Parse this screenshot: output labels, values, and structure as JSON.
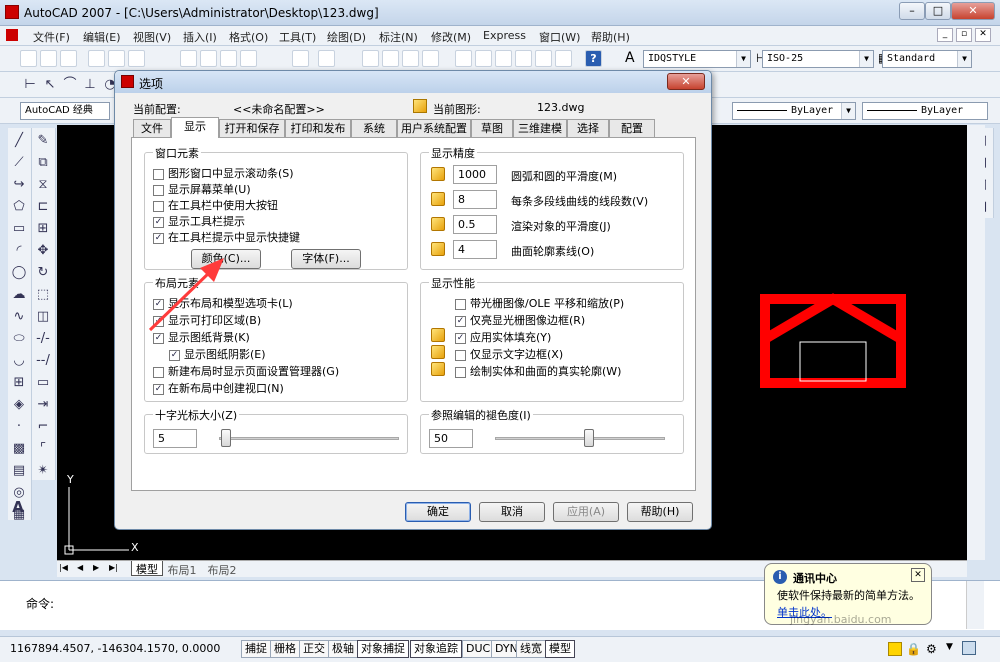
{
  "app": {
    "title": "AutoCAD 2007 - [C:\\Users\\Administrator\\Desktop\\123.dwg]"
  },
  "menu": [
    "文件(F)",
    "编辑(E)",
    "视图(V)",
    "插入(I)",
    "格式(O)",
    "工具(T)",
    "绘图(D)",
    "标注(N)",
    "修改(M)",
    "Express",
    "窗口(W)",
    "帮助(H)"
  ],
  "toolbar": {
    "textstyle": "IDQSTYLE",
    "dimstyle": "ISO-25",
    "tablestyle": "Standard",
    "workspace": "AutoCAD 经典",
    "linetype": "ByLayer",
    "lineweight": "ByLayer"
  },
  "dialog": {
    "title": "选项",
    "profile_label": "当前配置:",
    "profile_value": "<<未命名配置>>",
    "drawing_label": "当前图形:",
    "drawing_value": "123.dwg",
    "tabs": [
      "文件",
      "显示",
      "打开和保存",
      "打印和发布",
      "系统",
      "用户系统配置",
      "草图",
      "三维建模",
      "选择",
      "配置"
    ],
    "window_elements": {
      "title": "窗口元素",
      "items": [
        {
          "label": "图形窗口中显示滚动条(S)",
          "checked": false
        },
        {
          "label": "显示屏幕菜单(U)",
          "checked": false
        },
        {
          "label": "在工具栏中使用大按钮",
          "checked": false
        },
        {
          "label": "显示工具栏提示",
          "checked": true
        },
        {
          "label": "在工具栏提示中显示快捷键",
          "checked": true
        }
      ],
      "color_button": "颜色(C)...",
      "font_button": "字体(F)..."
    },
    "resolution": {
      "title": "显示精度",
      "items": [
        {
          "value": "1000",
          "label": "圆弧和圆的平滑度(M)"
        },
        {
          "value": "8",
          "label": "每条多段线曲线的线段数(V)"
        },
        {
          "value": "0.5",
          "label": "渲染对象的平滑度(J)"
        },
        {
          "value": "4",
          "label": "曲面轮廓素线(O)"
        }
      ]
    },
    "layout_elements": {
      "title": "布局元素",
      "items": [
        {
          "label": "显示布局和模型选项卡(L)",
          "checked": true
        },
        {
          "label": "显示可打印区域(B)",
          "checked": true
        },
        {
          "label": "显示图纸背景(K)",
          "checked": true
        },
        {
          "label": "显示图纸阴影(E)",
          "checked": true
        },
        {
          "label": "新建布局时显示页面设置管理器(G)",
          "checked": false
        },
        {
          "label": "在新布局中创建视口(N)",
          "checked": true
        }
      ]
    },
    "performance": {
      "title": "显示性能",
      "items": [
        {
          "label": "带光栅图像/OLE 平移和缩放(P)",
          "checked": false
        },
        {
          "label": "仅亮显光栅图像边框(R)",
          "checked": true
        },
        {
          "label": "应用实体填充(Y)",
          "checked": true
        },
        {
          "label": "仅显示文字边框(X)",
          "checked": false
        },
        {
          "label": "绘制实体和曲面的真实轮廓(W)",
          "checked": false
        }
      ]
    },
    "crosshair": {
      "title": "十字光标大小(Z)",
      "value": "5",
      "level": 5
    },
    "xref_fade": {
      "title": "参照编辑的褪色度(I)",
      "value": "50",
      "level": 50
    },
    "buttons": {
      "ok": "确定",
      "cancel": "取消",
      "apply": "应用(A)",
      "help": "帮助(H)"
    }
  },
  "layout_tabs": [
    "模型",
    "布局1",
    "布局2"
  ],
  "ucs": {
    "x": "X",
    "y": "Y"
  },
  "command": {
    "prompt": "命令:"
  },
  "status": {
    "coords": "1167894.4507, -146304.1570, 0.0000",
    "toggles": [
      {
        "label": "捕捉",
        "on": false
      },
      {
        "label": "栅格",
        "on": false
      },
      {
        "label": "正交",
        "on": false
      },
      {
        "label": "极轴",
        "on": false
      },
      {
        "label": "对象捕捉",
        "on": true
      },
      {
        "label": "对象追踪",
        "on": true
      },
      {
        "label": "DUCS",
        "on": false
      },
      {
        "label": "DYN",
        "on": false
      },
      {
        "label": "线宽",
        "on": false
      },
      {
        "label": "模型",
        "on": true
      }
    ]
  },
  "balloon": {
    "title": "通讯中心",
    "line1": "使软件保持最新的简单方法。",
    "link": "单击此处。"
  },
  "watermark": "jingyan.baidu.com",
  "colors": {
    "canvas": "#000000",
    "red": "#ff0000",
    "accent": "#2a5db0"
  }
}
